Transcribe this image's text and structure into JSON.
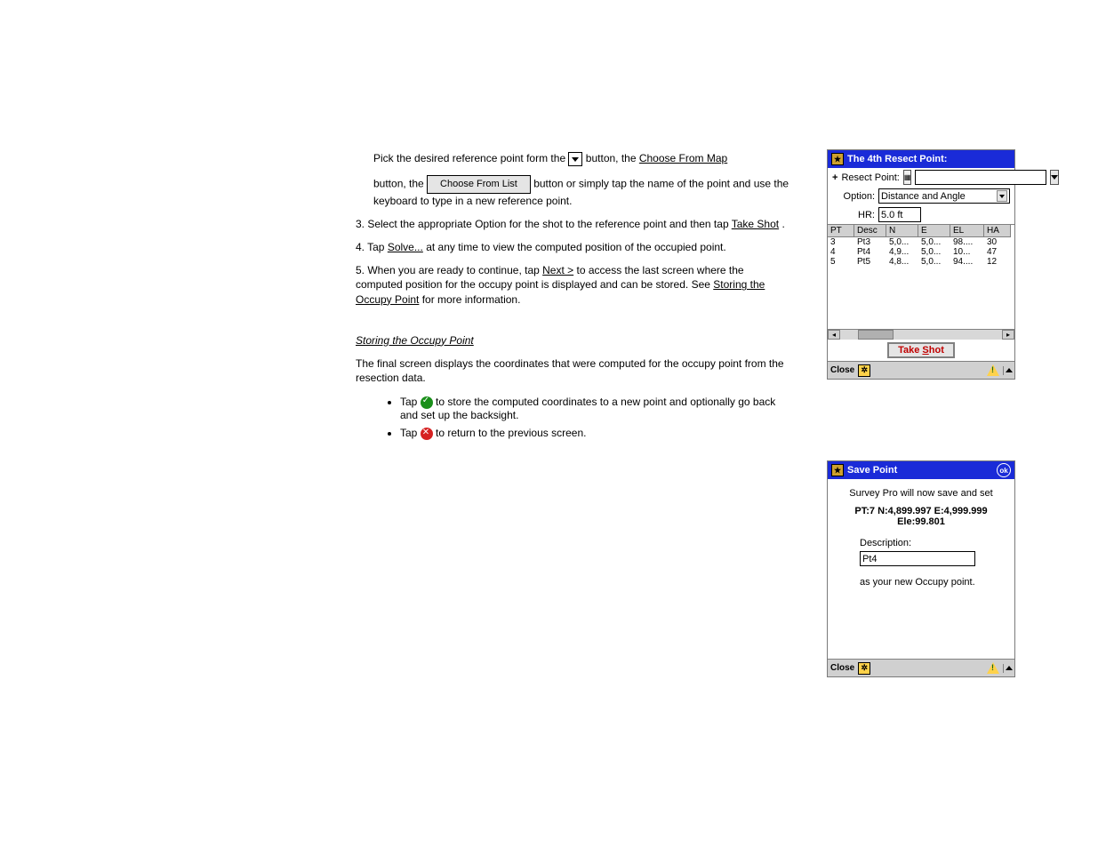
{
  "doc": {
    "p_prefix": "Pick the desired reference point form the ",
    "p_btn1": "Choose From Map",
    "p_btn2": "Choose From List",
    "p_mid": " button, the ",
    "p_suffix": " button or simply tap the name of the point and use the keyboard to type in a new reference point.",
    "step3_a": "3. Select the appropriate Option for the shot to the reference point and then tap ",
    "step3_b": ".",
    "step4": "4. Tap ",
    "step4_link": "Solve...",
    "step4_end": " at any time to view the computed position of the occupied point.",
    "step5": "5. When you are ready to continue, tap ",
    "step5_link": "Next >",
    "step5_end": " to access the last screen where the computed position for the occupy point is displayed and can be stored. See ",
    "step5_link2": "Storing the Occupy Point",
    "step5_tail": " for more information.",
    "h_store": "Storing the Occupy Point",
    "p_store": "The final screen displays the coordinates that were computed for the occupy point from the resection data.",
    "li1": "Tap ",
    "li1_end": " to store the computed coordinates to a new point and optionally go back and set up the backsight.",
    "li2": "Tap ",
    "li2_end": " to return to the previous screen."
  },
  "win1": {
    "title": "The 4th Resect Point:",
    "row1_label": "Resect Point:",
    "row2_label": "Option:",
    "option_value": "Distance and Angle",
    "row3_label": "HR:",
    "hr_value": "5.0 ft",
    "cols": [
      "PT",
      "Desc",
      "N",
      "E",
      "EL",
      "HA"
    ],
    "rows": [
      {
        "pt": "3",
        "desc": "Pt3",
        "n": "5,0...",
        "e": "5,0...",
        "el": "98....",
        "ha": "30"
      },
      {
        "pt": "4",
        "desc": "Pt4",
        "n": "4,9...",
        "e": "5,0...",
        "el": "10...",
        "ha": "47"
      },
      {
        "pt": "5",
        "desc": "Pt5",
        "n": "4,8...",
        "e": "5,0...",
        "el": "94....",
        "ha": "12"
      }
    ],
    "take_shot_pre": "Take ",
    "take_shot_s": "S",
    "take_shot_post": "hot",
    "close": "Close"
  },
  "win2": {
    "title": "Save Point",
    "msg": "Survey Pro will now save and set",
    "bold_line1": "PT:7  N:4,899.997  E:4,999.999",
    "bold_line2": "Ele:99.801",
    "desc_label": "Description:",
    "desc_value": "Pt4",
    "asnew": "as your new Occupy point.",
    "close": "Close"
  }
}
